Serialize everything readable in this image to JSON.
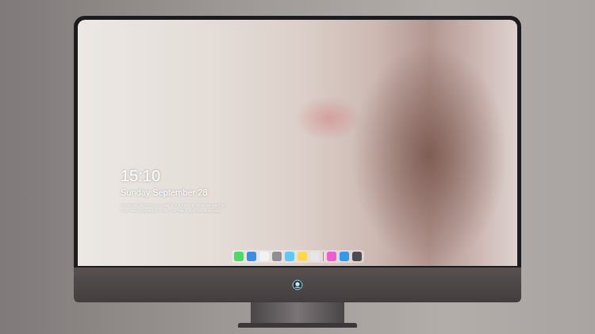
{
  "lock_screen": {
    "time": "15:10",
    "date": "Sunday September 28",
    "quote": [
      "Yesterday technology, today it is a trade of what we want to",
      "Your best companion is the one that is with you everyday"
    ]
  },
  "dock": {
    "apps": [
      {
        "color": "#4cd964"
      },
      {
        "color": "#3a8ee6"
      },
      {
        "color": "#f2f2f2"
      },
      {
        "color": "#8e8e93"
      },
      {
        "color": "#5ac8fa"
      },
      {
        "color": "#ffd84a"
      },
      {
        "color": "#e5e5ea"
      }
    ],
    "extras": [
      {
        "color": "#f05ad2"
      },
      {
        "color": "#2f9bf0"
      },
      {
        "color": "#4a4a4f"
      }
    ]
  }
}
